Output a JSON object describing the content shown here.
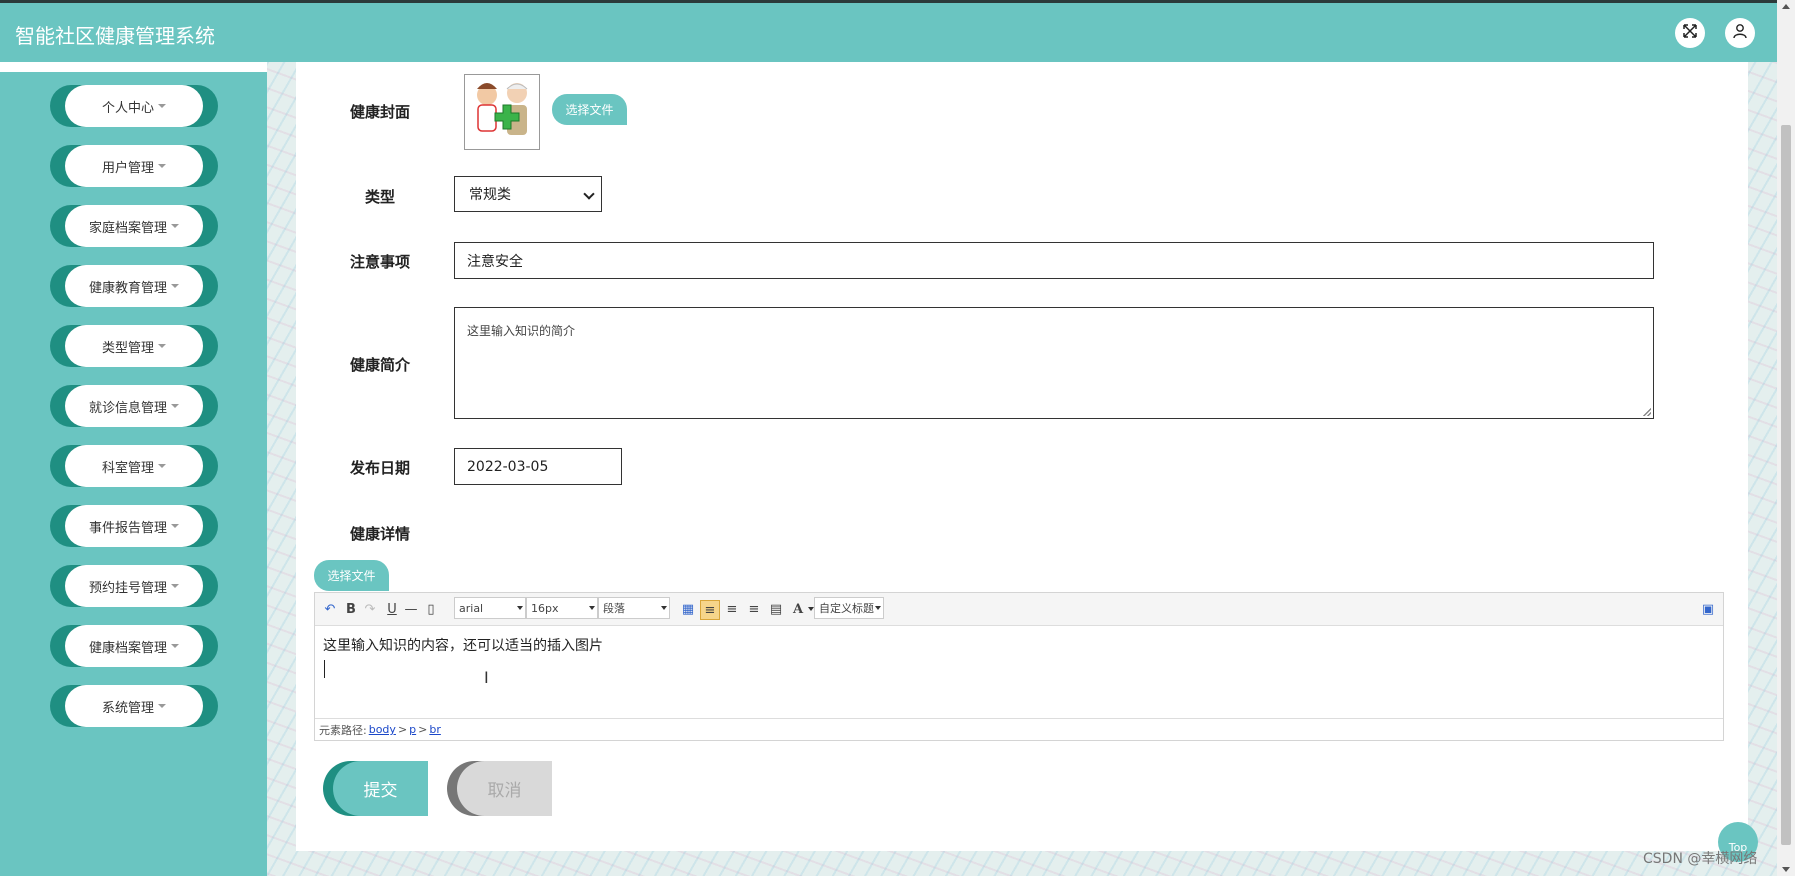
{
  "header": {
    "title": "智能社区健康管理系统"
  },
  "sidebar": {
    "items": [
      {
        "label": "个人中心"
      },
      {
        "label": "用户管理"
      },
      {
        "label": "家庭档案管理"
      },
      {
        "label": "健康教育管理"
      },
      {
        "label": "类型管理"
      },
      {
        "label": "就诊信息管理"
      },
      {
        "label": "科室管理"
      },
      {
        "label": "事件报告管理"
      },
      {
        "label": "预约挂号管理"
      },
      {
        "label": "健康档案管理"
      },
      {
        "label": "系统管理"
      }
    ]
  },
  "form": {
    "cover_label": "健康封面",
    "choose_file_label": "选择文件",
    "type_label": "类型",
    "type_value": "常规类",
    "notes_label": "注意事项",
    "notes_value": "注意安全",
    "intro_label": "健康简介",
    "intro_value": "这里输入知识的简介",
    "date_label": "发布日期",
    "date_value": "2022-03-05",
    "detail_label": "健康详情",
    "detail_choose_file_label": "选择文件"
  },
  "editor": {
    "font_family": "arial",
    "font_size": "16px",
    "paragraph": "段落",
    "custom_title": "自定义标题",
    "content": "这里输入知识的内容，还可以适当的插入图片",
    "path_label": "元素路径:",
    "path": [
      "body",
      "p",
      "br"
    ]
  },
  "actions": {
    "submit_label": "提交",
    "cancel_label": "取消"
  },
  "misc": {
    "top_label": "Top",
    "watermark": "CSDN @幸横网络"
  },
  "colors": {
    "primary": "#6ac5c1",
    "primary_dark": "#1f8f82"
  }
}
